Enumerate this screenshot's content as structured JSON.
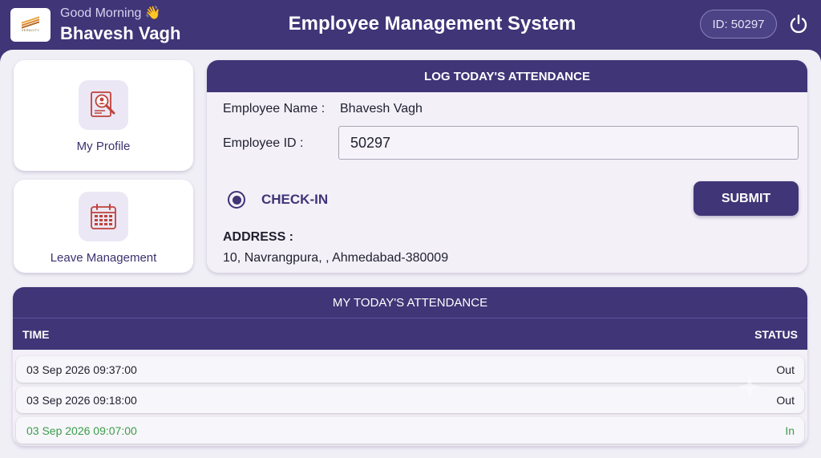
{
  "header": {
    "greeting": "Good Morning",
    "greeting_emoji": "👋",
    "user_name": "Bhavesh Vagh",
    "app_title": "Employee Management System",
    "id_badge": "ID: 50297",
    "logo_text": "VERACITY",
    "power_icon": "power-icon"
  },
  "tiles": [
    {
      "label": "My Profile",
      "icon": "profile-search-icon"
    },
    {
      "label": "Leave Management",
      "icon": "calendar-icon"
    }
  ],
  "attendance_form": {
    "title": "LOG TODAY'S ATTENDANCE",
    "employee_name_label": "Employee Name :",
    "employee_name_value": "Bhavesh Vagh",
    "employee_id_label": "Employee ID :",
    "employee_id_value": "50297",
    "check_option_label": "CHECK-IN",
    "check_option_selected": true,
    "submit_label": "SUBMIT",
    "address_label": "ADDRESS :",
    "address_value": "10, Navrangpura, , Ahmedabad-380009"
  },
  "today_attendance": {
    "title": "MY TODAY'S ATTENDANCE",
    "columns": [
      "TIME",
      "STATUS"
    ],
    "rows": [
      {
        "time": "03 Sep 2026 09:37:00",
        "status": "Out"
      },
      {
        "time": "03 Sep 2026 09:18:00",
        "status": "Out"
      },
      {
        "time": "03 Sep 2026 09:07:00",
        "status": "In"
      }
    ]
  },
  "colors": {
    "primary": "#3f3577",
    "background": "#f1eff6",
    "status_in": "#3a9d4a",
    "icon_accent": "#c0423a"
  }
}
